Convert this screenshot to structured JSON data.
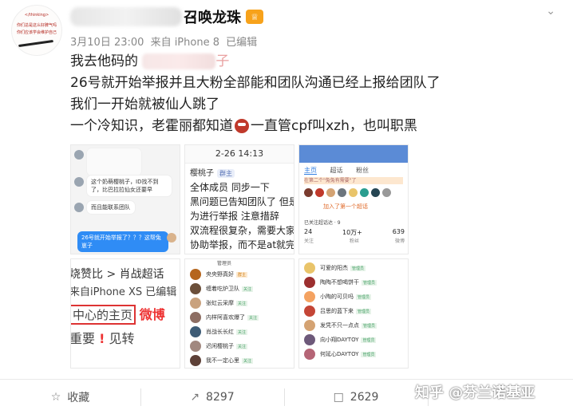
{
  "post": {
    "author_suffix": "召唤龙珠",
    "vip_badge": "♕",
    "timestamp": "3月10日 23:00",
    "source": "来自 iPhone 8",
    "edited": "已编辑",
    "avatar_text": "</thinking>",
    "avatar_text_2": "你们总是这么好脾气吗",
    "avatar_text_3": "你们应该学会维护自己",
    "line1_prefix": "我去他码的",
    "line1_suffix": "子",
    "line2": "26号就开始举报并且大粉全部能和团队沟通已经上报给团队了",
    "line3": "我们一开始就被仙人跳了",
    "line4_a": "一个冷知识，老霍丽都知道",
    "line4_b": "一直管cpf叫xzh，也叫职黑"
  },
  "images": {
    "chat": {
      "b1": "这个奶萌樱桃子，ID找不到了，比巴拉拉仙女还要早",
      "b2": "而且能联系团队",
      "b3": "26号就开始举报了？？？这帮兔崽子"
    },
    "doc": {
      "time": "2-26 14:13",
      "name": "樱桃子",
      "tag": "群主",
      "l1": "全体成员 同步一下",
      "l2": "黑问题已告知团队了 但是",
      "l3": "为进行举报 注意措辞",
      "l4": "双流程很复杂，需要大家一",
      "l5": "协助举报，而不是at就完事"
    },
    "profile": {
      "tab1": "主页",
      "tab2": "超话",
      "tab3": "粉丝",
      "banner": "在第二个\"兔兔有需要\"了",
      "join": "加入了第一个超话",
      "sub": "已关注超话达 · 9",
      "s1": "24",
      "s2": "10万+",
      "s3": "639",
      "t1": "关注",
      "t2": "粉丝",
      "t3": "微博"
    },
    "weibo": {
      "r1": "烧赞比 > 肖战超话",
      "r2": "来自iPhone XS 已编辑",
      "r3a": "中心的主页",
      "r3b": "微博",
      "r4a": "重要",
      "r4b": "!",
      "r4c": "见转"
    },
    "list1": [
      "央央野真好",
      "缠着吃炉卫队",
      "张虹云采摩",
      "内样阿喜欢爆了",
      "肖战长长红",
      "迟闲樱桃子",
      "我不一定心里"
    ],
    "list1_header": "管理员",
    "list1_tag": "关注",
    "list1_tag_owner": "群主",
    "list2": [
      "可爱的阳杰",
      "陶陶不想喝饼干",
      "小陶的可贝吗",
      "吕思的蓝下来",
      "发凭不只一点点",
      "向小翔DAYTOY",
      "何延心DAYTOY"
    ],
    "list2_tag": "管理员"
  },
  "footer": {
    "fav": "收藏",
    "repost": "8297",
    "comment": "2629",
    "watermark": "知乎 @芬兰诺基亚"
  },
  "colors": {
    "accent_blue": "#2f8cf5",
    "weibo_red": "#e33",
    "vip_orange": "#f7a21b"
  }
}
